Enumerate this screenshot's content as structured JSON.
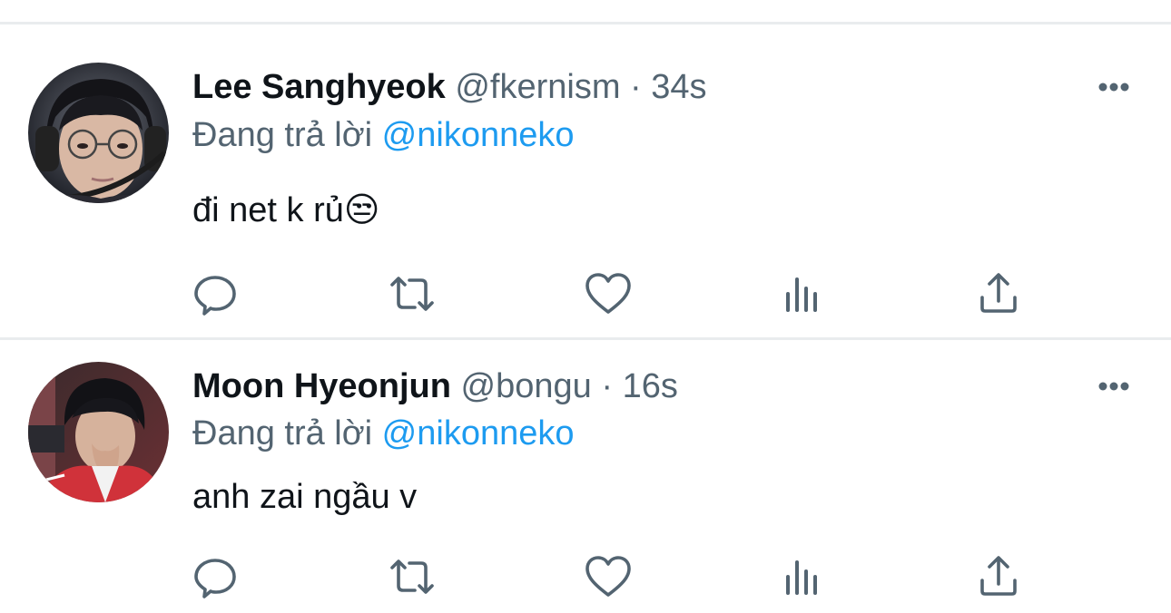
{
  "tweets": [
    {
      "name": "Lee Sanghyeok",
      "handle": "@fkernism",
      "separator": "·",
      "time": "34s",
      "reply_prefix": "Đang trả lời",
      "reply_to": "@nikonneko",
      "text": "đi net k rủ😒"
    },
    {
      "name": "Moon Hyeonjun",
      "handle": "@bongu",
      "separator": "·",
      "time": "16s",
      "reply_prefix": "Đang trả lời",
      "reply_to": "@nikonneko",
      "text": "anh zai ngầu v"
    }
  ],
  "colors": {
    "text_primary": "#0f1419",
    "text_secondary": "#536471",
    "link": "#1d9bf0",
    "divider": "#e9ecee"
  },
  "icons": {
    "more": "more-horizontal-icon",
    "reply": "reply-icon",
    "retweet": "retweet-icon",
    "like": "heart-icon",
    "views": "bar-chart-icon",
    "share": "share-icon"
  }
}
